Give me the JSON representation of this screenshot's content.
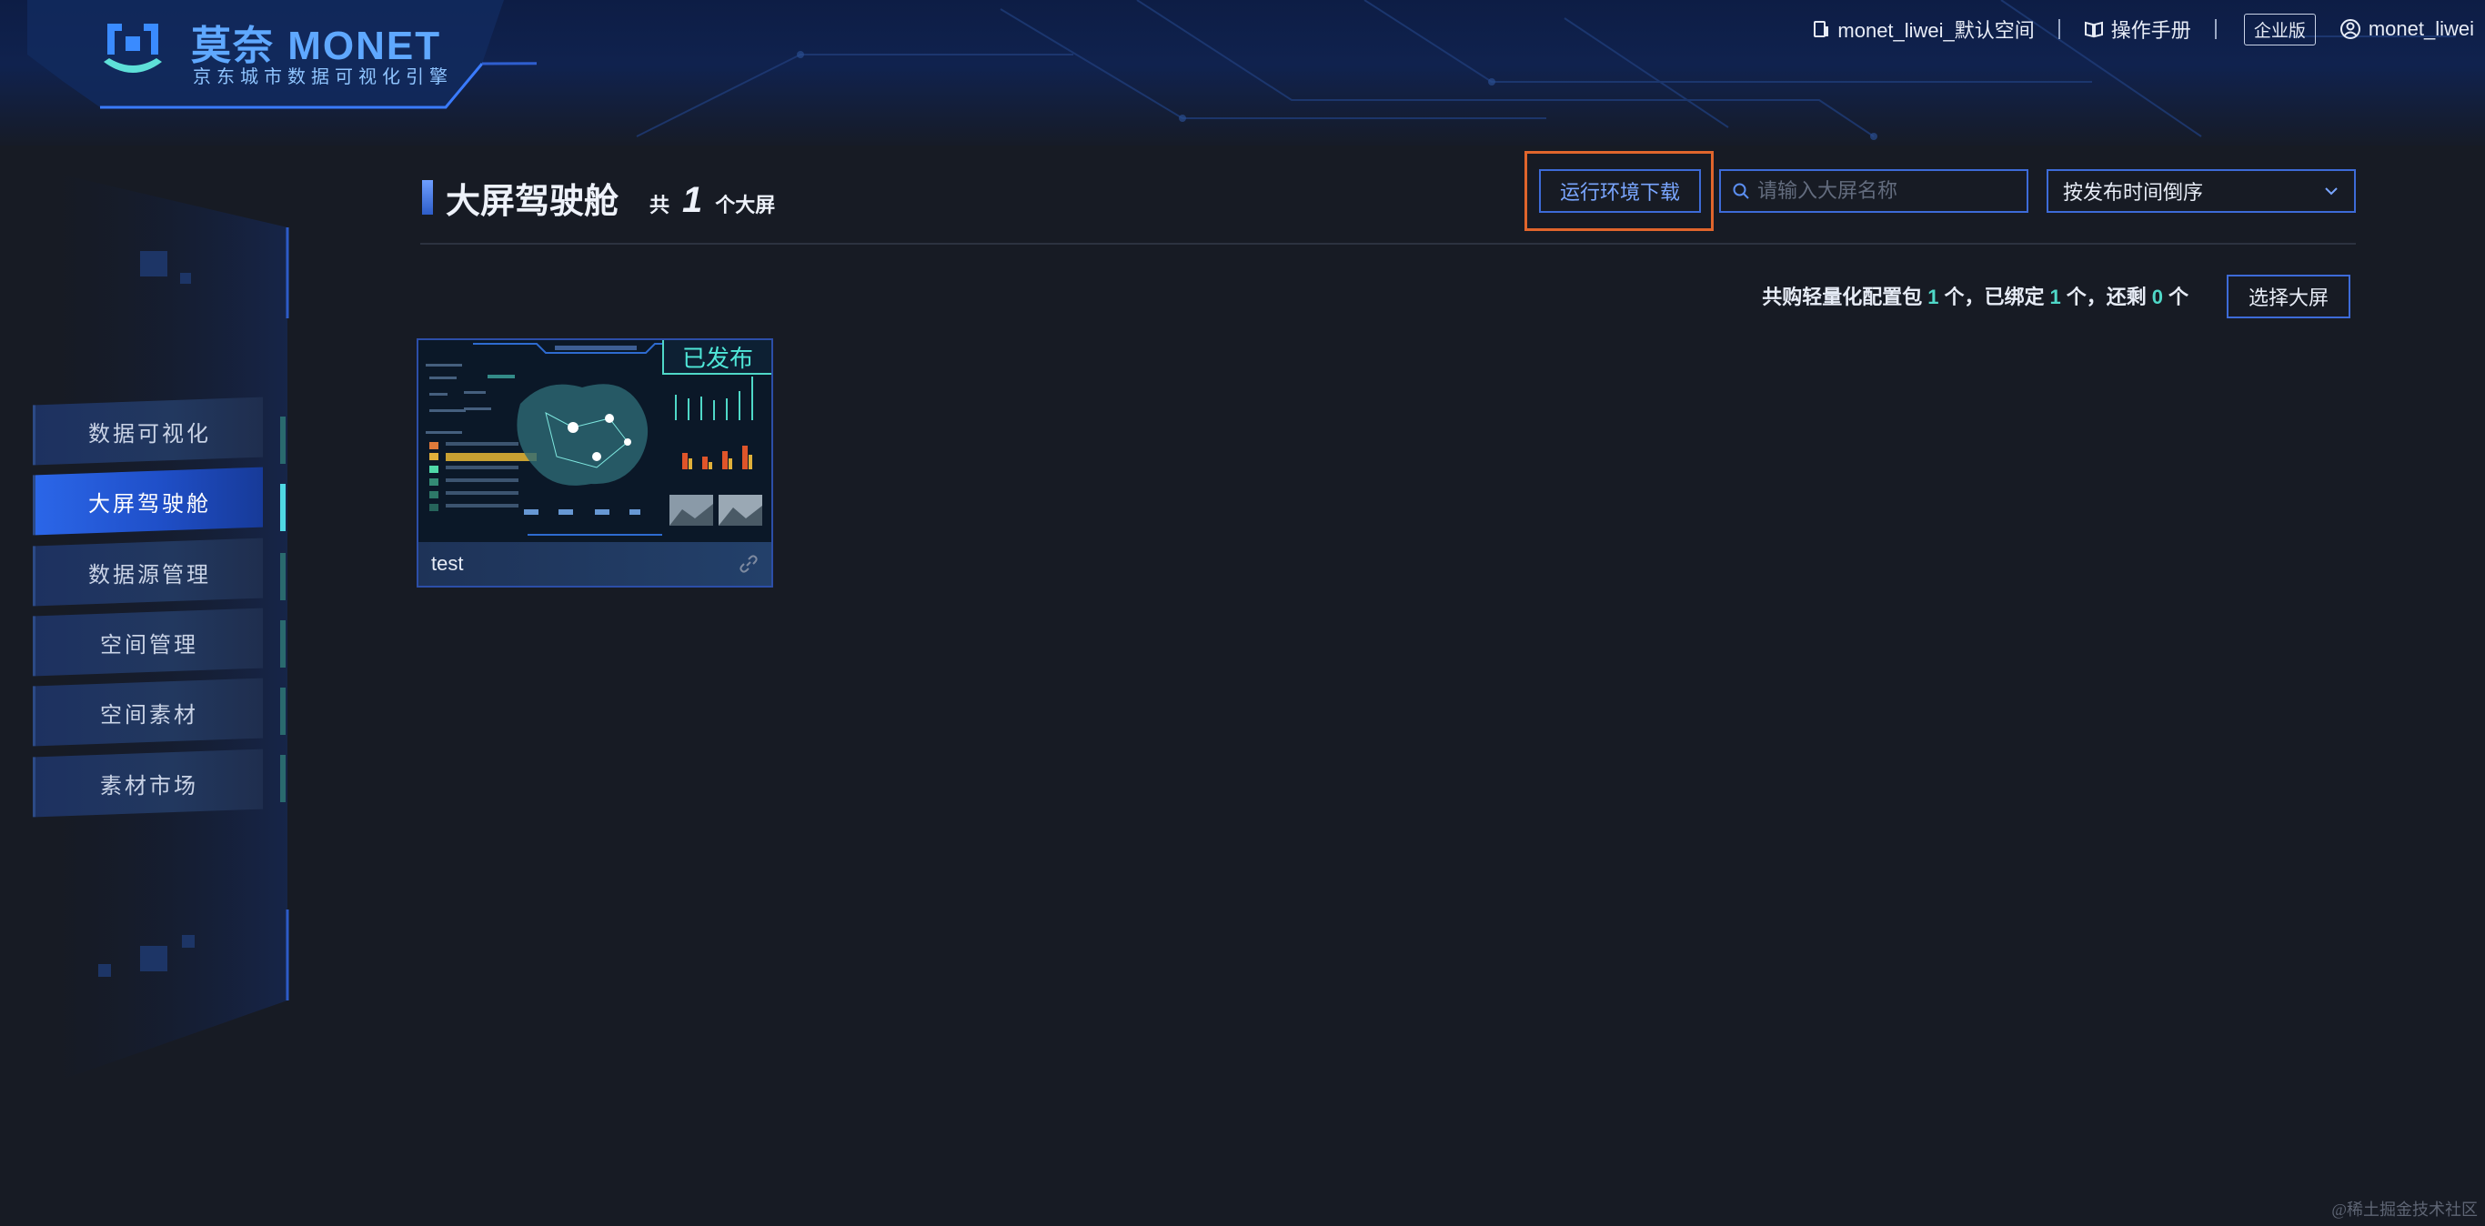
{
  "app": {
    "logo_title": "莫奈 MONET",
    "logo_subtitle": "京东城市数据可视化引擎"
  },
  "topnav": {
    "workspace": "monet_liwei_默认空间",
    "manual": "操作手册",
    "edition": "企业版",
    "user": "monet_liwei"
  },
  "sidebar": {
    "items": [
      {
        "label": "数据可视化",
        "active": false
      },
      {
        "label": "大屏驾驶舱",
        "active": true
      },
      {
        "label": "数据源管理",
        "active": false
      },
      {
        "label": "空间管理",
        "active": false
      },
      {
        "label": "空间素材",
        "active": false
      },
      {
        "label": "素材市场",
        "active": false
      }
    ]
  },
  "main": {
    "title": "大屏驾驶舱",
    "count_prefix": "共",
    "count": "1",
    "count_suffix": "个大屏",
    "download_button": "运行环境下载",
    "search_placeholder": "请输入大屏名称",
    "sort_value": "按发布时间倒序",
    "quota": {
      "p1": "共购轻量化配置包",
      "purchased": "1",
      "p2": "个，已绑定",
      "bound": "1",
      "p3": "个，还剩",
      "remaining": "0",
      "p4": "个"
    },
    "select_button": "选择大屏"
  },
  "cards": [
    {
      "name": "test",
      "status": "已发布"
    }
  ],
  "watermark": "@稀土掘金技术社区",
  "colors": {
    "accent": "#3d6bd8",
    "highlight": "#e0652c",
    "teal": "#4fd8c8",
    "background": "#171b24"
  }
}
